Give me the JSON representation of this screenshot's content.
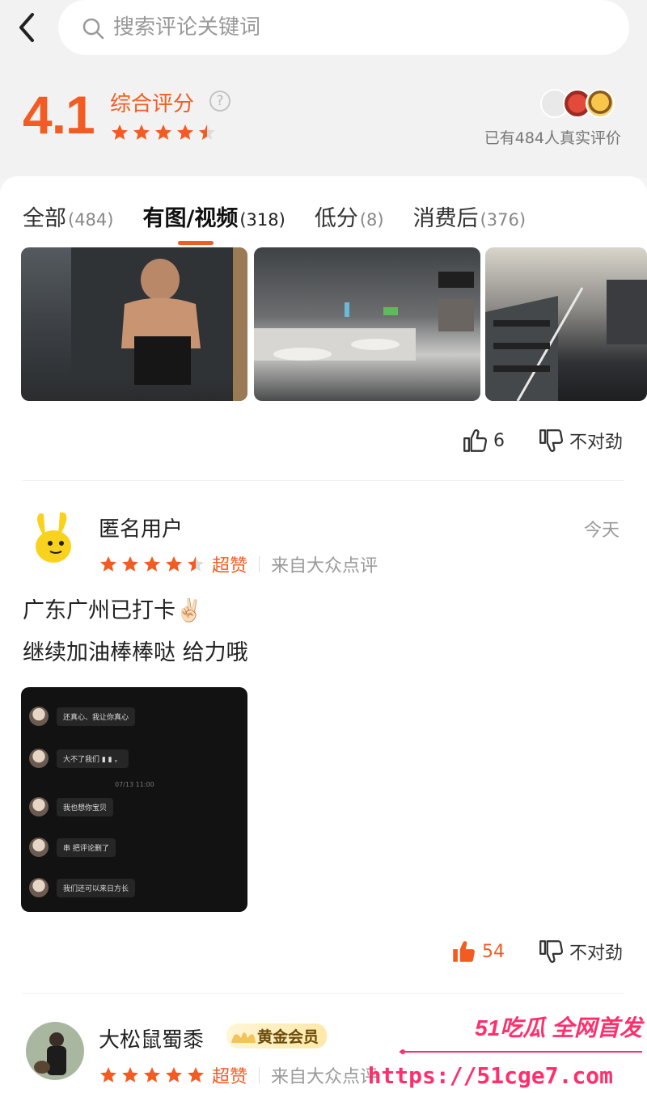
{
  "search": {
    "placeholder": "搜索评论关键词"
  },
  "rating": {
    "score": "4.1",
    "label": "综合评分",
    "stars": 4.5,
    "review_count_text": "已有484人真实评价"
  },
  "tabs": [
    {
      "label": "全部",
      "count": "(484)"
    },
    {
      "label": "有图/视频",
      "count": "(318)"
    },
    {
      "label": "低分",
      "count": "(8)"
    },
    {
      "label": "消费后",
      "count": "(376)"
    }
  ],
  "active_tab": 1,
  "review0": {
    "likes": "6",
    "dislike_label": "不对劲"
  },
  "review1": {
    "user": "匿名用户",
    "date": "今天",
    "stars": 4.5,
    "praise": "超赞",
    "source": "来自大众点评",
    "text_line1": "广东广州已打卡✌🏻",
    "text_line2": "继续加油棒棒哒 给力哦",
    "chat": [
      "还真心、我让你真心",
      "大不了我们 ▮ ▮ 。",
      "07/13 11:00",
      "我也想你宝贝",
      "串 把评论删了",
      "我们还可以来日方长"
    ],
    "likes": "54",
    "dislike_label": "不对劲"
  },
  "review2": {
    "user": "大松鼠蜀黍",
    "badge": "黄金会员",
    "stars": 5,
    "praise": "超赞",
    "source": "来自大众点评"
  },
  "watermark": {
    "brand": "51吃瓜 全网首发",
    "url": "https://51cge7.com"
  },
  "colors": {
    "accent": "#f25c22",
    "watermark": "#ff2f6d"
  }
}
